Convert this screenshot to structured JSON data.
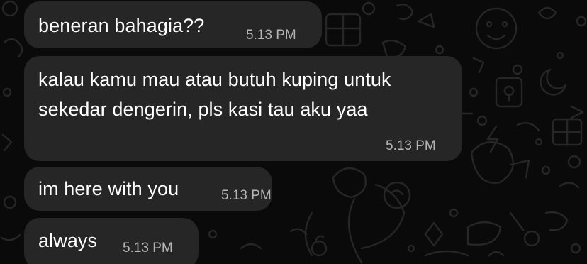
{
  "wallpaper": {
    "background_color": "#0a0a0a",
    "doodle_color": "#2a2a2a"
  },
  "bubble_color": "#262626",
  "messages": [
    {
      "text": "beneran bahagia??",
      "time": "5.13 PM"
    },
    {
      "text": "kalau kamu mau atau butuh kuping untuk sekedar dengerin, pls kasi tau aku yaa",
      "time": "5.13 PM"
    },
    {
      "text": "im here with you",
      "time": "5.13 PM"
    },
    {
      "text": "always",
      "time": "5.13 PM"
    }
  ]
}
